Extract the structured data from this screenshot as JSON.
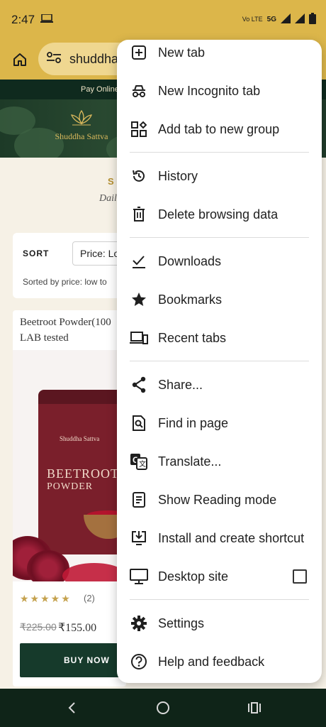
{
  "status_bar": {
    "time": "2:47",
    "network": "5G",
    "volte": "Vo LTE"
  },
  "toolbar": {
    "url": "shuddhas"
  },
  "page": {
    "promo": "Pay Online",
    "logo_name": "Shuddha Sattva",
    "section_heading": "S",
    "section_subtitle": "Dail",
    "sort_label": "SORT",
    "sort_value": "Price: Lo",
    "sorted_by": "Sorted by price: low to",
    "product": {
      "title_line1": "Beetroot Powder(100",
      "title_line2": "LAB tested",
      "pouch_brand": "Shuddha Sattva",
      "pouch_name1": "BEETROOT",
      "pouch_name2": "POWDER",
      "stars": "★★★★★",
      "rating_value": 5,
      "rating_count": "(2)",
      "price_old": "₹225.00",
      "price_new": "₹155.00",
      "buy_label": "BUY NOW"
    }
  },
  "menu": {
    "items": [
      {
        "label": "New tab",
        "icon": "new-tab-icon"
      },
      {
        "label": "New Incognito tab",
        "icon": "incognito-icon"
      },
      {
        "label": "Add tab to new group",
        "icon": "tab-group-icon"
      },
      {
        "label": "History",
        "icon": "history-icon"
      },
      {
        "label": "Delete browsing data",
        "icon": "trash-icon"
      },
      {
        "label": "Downloads",
        "icon": "download-icon"
      },
      {
        "label": "Bookmarks",
        "icon": "star-icon"
      },
      {
        "label": "Recent tabs",
        "icon": "devices-icon"
      },
      {
        "label": "Share...",
        "icon": "share-icon"
      },
      {
        "label": "Find in page",
        "icon": "find-icon"
      },
      {
        "label": "Translate...",
        "icon": "translate-icon"
      },
      {
        "label": "Show Reading mode",
        "icon": "reading-mode-icon"
      },
      {
        "label": "Install and create shortcut",
        "icon": "install-icon"
      },
      {
        "label": "Desktop site",
        "icon": "desktop-icon",
        "checked": false
      },
      {
        "label": "Settings",
        "icon": "gear-icon"
      },
      {
        "label": "Help and feedback",
        "icon": "help-icon"
      }
    ]
  },
  "colors": {
    "toolbar": "#dcb64a",
    "brand_green": "#163a2b",
    "gold": "#c5a24e"
  }
}
